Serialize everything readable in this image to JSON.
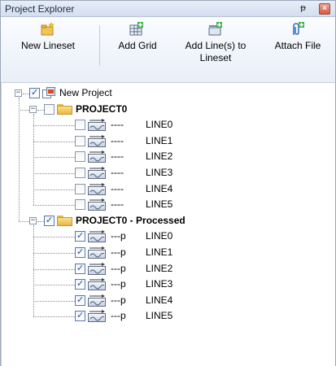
{
  "window": {
    "title": "Project Explorer",
    "pin_glyph": "ᵽ",
    "close_glyph": "×"
  },
  "toolbar": {
    "buttons": [
      {
        "label": "New Lineset",
        "icon": "new-folder-icon"
      },
      {
        "label": "Add Grid",
        "icon": "add-grid-icon"
      },
      {
        "label": "Add Line(s) to Lineset",
        "icon": "add-lines-icon"
      },
      {
        "label": "Attach File",
        "icon": "attach-file-icon"
      }
    ]
  },
  "tree": {
    "root": {
      "label": "New Project",
      "checked": true,
      "expander": "−"
    },
    "groups": [
      {
        "label": "PROJECT0",
        "checked": false,
        "expander": "−",
        "items": [
          {
            "code": "----",
            "name": "LINE0",
            "checked": false
          },
          {
            "code": "----",
            "name": "LINE1",
            "checked": false
          },
          {
            "code": "----",
            "name": "LINE2",
            "checked": false
          },
          {
            "code": "----",
            "name": "LINE3",
            "checked": false
          },
          {
            "code": "----",
            "name": "LINE4",
            "checked": false
          },
          {
            "code": "----",
            "name": "LINE5",
            "checked": false
          }
        ]
      },
      {
        "label": "PROJECT0 - Processed",
        "checked": true,
        "expander": "−",
        "items": [
          {
            "code": "---p",
            "name": "LINE0",
            "checked": true
          },
          {
            "code": "---p",
            "name": "LINE1",
            "checked": true
          },
          {
            "code": "---p",
            "name": "LINE2",
            "checked": true
          },
          {
            "code": "---p",
            "name": "LINE3",
            "checked": true
          },
          {
            "code": "---p",
            "name": "LINE4",
            "checked": true
          },
          {
            "code": "---p",
            "name": "LINE5",
            "checked": true
          }
        ]
      }
    ]
  },
  "colors": {
    "folder": "#e9b748",
    "checkmark": "#2a4a8a",
    "title_bar": "#d3deef"
  }
}
